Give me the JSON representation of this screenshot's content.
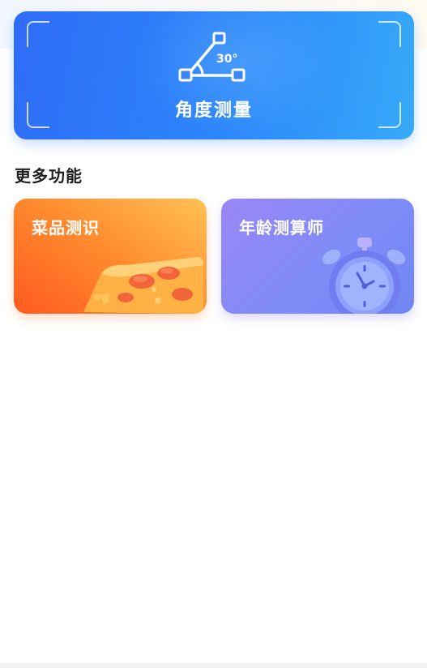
{
  "hero": {
    "title": "角度测量",
    "angle_label": "30°",
    "icon": "angle-measure-icon",
    "gradient": [
      "#2f6cf6",
      "#36aaf8"
    ]
  },
  "section": {
    "title": "更多功能"
  },
  "cards": [
    {
      "label": "菜品测识",
      "icon": "pizza-icon",
      "color": "#ff7a2b"
    },
    {
      "label": "年龄测算师",
      "icon": "alarm-clock-icon",
      "color": "#8a8af7"
    }
  ]
}
